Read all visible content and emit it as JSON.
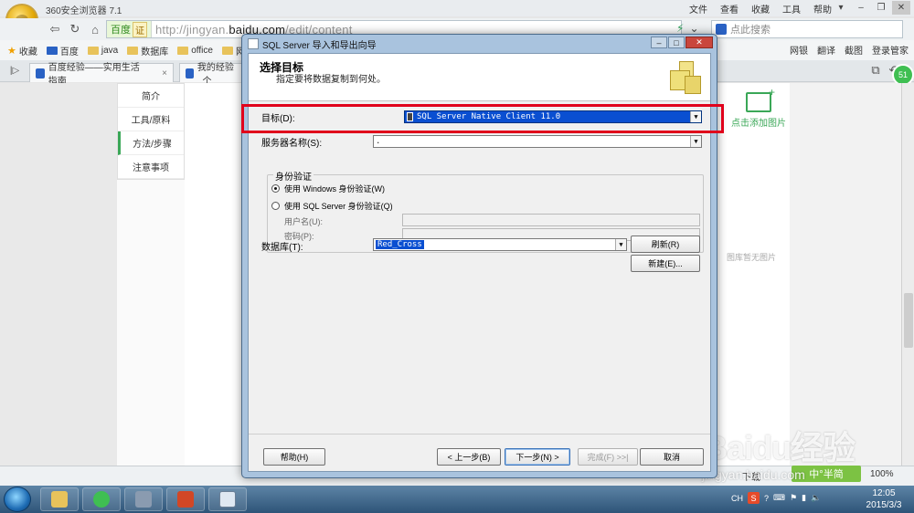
{
  "browser": {
    "name": "360安全浏览器 7.1",
    "menu": [
      "文件",
      "查看",
      "收藏",
      "工具",
      "帮助"
    ],
    "address_badge": "百度",
    "address_badge_tag": "证",
    "url_prefix": "http://jingyan.",
    "url_domain": "baidu.com",
    "url_suffix": "/edit/content",
    "search_placeholder": "点此搜索",
    "bookmarks": [
      "收藏",
      "百度",
      "java",
      "数据库",
      "office",
      "网页制"
    ],
    "bookmarks_right": [
      "网银",
      "翻译",
      "截图",
      "登录管家"
    ],
    "tabs": [
      {
        "label": "百度经验——实用生活指南"
      },
      {
        "label": "我的经验_个"
      }
    ],
    "badge": "51"
  },
  "page": {
    "nav": [
      "简介",
      "工具/原料",
      "方法/步骤",
      "注意事项"
    ],
    "active_nav": "方法/步骤",
    "add_image": "点击添加图片",
    "no_image": "图库暂无图片",
    "ime": "中°半简",
    "download": "下载",
    "zoom": "100%",
    "watermark": "Baidu经验",
    "watermark_url": "jingyan.baidu.com"
  },
  "dialog": {
    "title": "SQL Server 导入和导出向导",
    "header_title": "选择目标",
    "header_subtitle": "指定要将数据复制到何处。",
    "target_label": "目标(D):",
    "target_value": "SQL Server Native Client 11.0",
    "server_label": "服务器名称(S):",
    "server_value": ".",
    "auth_group": "身份验证",
    "auth_windows": "使用 Windows 身份验证(W)",
    "auth_sql": "使用 SQL Server 身份验证(Q)",
    "username_label": "用户名(U):",
    "password_label": "密码(P):",
    "database_label": "数据库(T):",
    "database_value": "Red_Cross",
    "refresh_button": "刷新(R)",
    "new_button": "新建(E)...",
    "help_button": "帮助(H)",
    "back_button": "< 上一步(B)",
    "next_button": "下一步(N) >",
    "finish_button": "完成(F) >>|",
    "cancel_button": "取消"
  },
  "taskbar": {
    "tray_lang": "CH",
    "tray_s": "S",
    "time": "12:05",
    "date": "2015/3/3"
  }
}
